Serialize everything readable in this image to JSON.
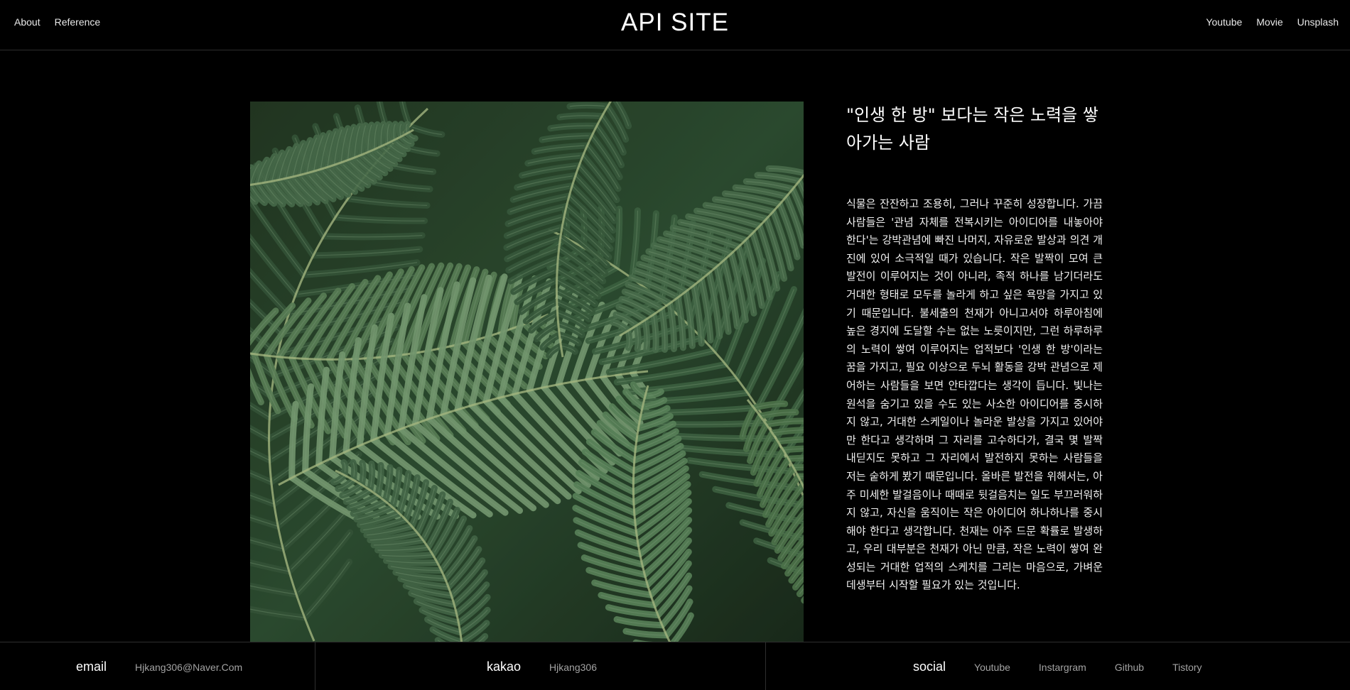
{
  "header": {
    "nav_left": [
      "About",
      "Reference"
    ],
    "title": "API SITE",
    "nav_right": [
      "Youtube",
      "Movie",
      "Unsplash"
    ]
  },
  "article": {
    "title": "\"인생 한 방\" 보다는 작은 노력을 쌓아가는 사람",
    "body": "식물은 잔잔하고 조용히, 그러나 꾸준히 성장합니다. 가끔 사람들은 '관념 자체를 전복시키는 아이디어를 내놓아야 한다'는 강박관념에 빠진 나머지, 자유로운 발상과 의견 개진에 있어 소극적일 때가 있습니다. 작은 발짝이 모여 큰 발전이 이루어지는 것이 아니라, 족적 하나를 남기더라도 거대한 형태로 모두를 놀라게 하고 싶은 욕망을 가지고 있기 때문입니다. 불세출의 천재가 아니고서야 하루아침에 높은 경지에 도달할 수는 없는 노릇이지만, 그런 하루하루의 노력이 쌓여 이루어지는 업적보다 '인생 한 방'이라는 꿈을 가지고, 필요 이상으로 두뇌 활동을 강박 관념으로 제어하는 사람들을 보면 안타깝다는 생각이 듭니다. 빛나는 원석을 숨기고 있을 수도 있는 사소한 아이디어를 중시하지 않고, 거대한 스케일이나 놀라운 발상을 가지고 있어야만 한다고 생각하며 그 자리를 고수하다가, 결국 몇 발짝 내딛지도 못하고 그 자리에서 발전하지 못하는 사람들을 저는 숱하게 봤기 때문입니다. 올바른 발전을 위해서는, 아주 미세한 발걸음이나 때때로 뒷걸음치는 일도 부끄러워하지 않고, 자신을 움직이는 작은 아이디어 하나하나를 중시해야 한다고 생각합니다. 천재는 아주 드문 확률로 발생하고, 우리 대부분은 천재가 아닌 만큼, 작은 노력이 쌓여 완성되는 거대한 업적의 스케치를 그리는 마음으로, 가벼운 데생부터 시작할 필요가 있는 것입니다."
  },
  "footer": {
    "email_label": "email",
    "email_value": "Hjkang306@Naver.Com",
    "kakao_label": "kakao",
    "kakao_value": "Hjkang306",
    "social_label": "social",
    "social_links": [
      "Youtube",
      "Instargram",
      "Github",
      "Tistory"
    ]
  },
  "colors": {
    "background": "#000000",
    "text": "#ffffff",
    "muted_text": "#a3a3a3",
    "divider": "#2e2e2e",
    "leaf_dark": "#25402a",
    "leaf_light": "#8eb08a"
  }
}
